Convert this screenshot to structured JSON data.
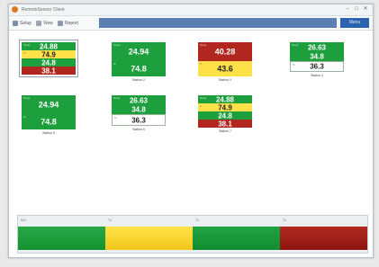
{
  "window": {
    "title": "RemoteSensor Client"
  },
  "titlebar": {
    "minimize": "–",
    "maximize": "□",
    "close": "✕"
  },
  "toolbar": {
    "setup_label": "Setup",
    "view_label": "View",
    "report_label": "Report",
    "main_button_label": "Menu"
  },
  "cards": [
    {
      "label": "Station 1",
      "rows": [
        {
          "color": "#1e9f3e",
          "value": "24.88",
          "corner": "Temp"
        },
        {
          "color": "#ffe24a",
          "value": "74.9",
          "corner": "%"
        },
        {
          "color": "#1e9f3e",
          "value": "24.8",
          "corner": ""
        },
        {
          "color": "#b1261f",
          "value": "38.1",
          "corner": ""
        }
      ]
    },
    {
      "label": "Station 2",
      "rows": [
        {
          "color": "#1e9f3e",
          "value": "24.94",
          "corner": "Temp"
        },
        {
          "color": "#1e9f3e",
          "value": "74.8",
          "corner": "%"
        }
      ]
    },
    {
      "label": "Station 3",
      "rows": [
        {
          "color": "#b1261f",
          "value": "40.28",
          "corner": "Temp"
        },
        {
          "color": "#ffe24a",
          "value": "43.6",
          "corner": "%"
        }
      ]
    },
    {
      "label": "Station 4",
      "rows": [
        {
          "color": "#1e9f3e",
          "value": "26.63",
          "corner": "Temp"
        },
        {
          "color": "#1e9f3e",
          "value": "34.8",
          "corner": ""
        },
        {
          "color": "#ffffff",
          "value": "36.3",
          "corner": "%"
        }
      ]
    },
    {
      "label": "Station 5",
      "rows": [
        {
          "color": "#1e9f3e",
          "value": "24.94",
          "corner": "Temp"
        },
        {
          "color": "#1e9f3e",
          "value": "74.8",
          "corner": "%"
        }
      ]
    },
    {
      "label": "Station 6",
      "rows": [
        {
          "color": "#1e9f3e",
          "value": "26.63",
          "corner": "Temp"
        },
        {
          "color": "#1e9f3e",
          "value": "34.8",
          "corner": ""
        },
        {
          "color": "#ffffff",
          "value": "36.3",
          "corner": "%"
        }
      ]
    },
    {
      "label": "Station 7",
      "rows": [
        {
          "color": "#1e9f3e",
          "value": "24.88",
          "corner": "Temp"
        },
        {
          "color": "#ffe24a",
          "value": "74.9",
          "corner": "%"
        },
        {
          "color": "#1e9f3e",
          "value": "24.8",
          "corner": ""
        },
        {
          "color": "#b1261f",
          "value": "38.1",
          "corner": ""
        }
      ]
    }
  ],
  "bottom": {
    "strips": [
      {
        "label": "Min",
        "color": "#1e9f3e"
      },
      {
        "label": "Tu",
        "color": "#f5d52d"
      },
      {
        "label": "Tu",
        "color": "#1e9f3e"
      },
      {
        "label": "Tu",
        "color": "#a11e18"
      }
    ]
  },
  "colors": {
    "green": "#1e9f3e",
    "yellow": "#ffe24a",
    "red": "#b1261f",
    "toolbar_accent": "#5b7fb3",
    "main_button": "#2b63b0"
  }
}
